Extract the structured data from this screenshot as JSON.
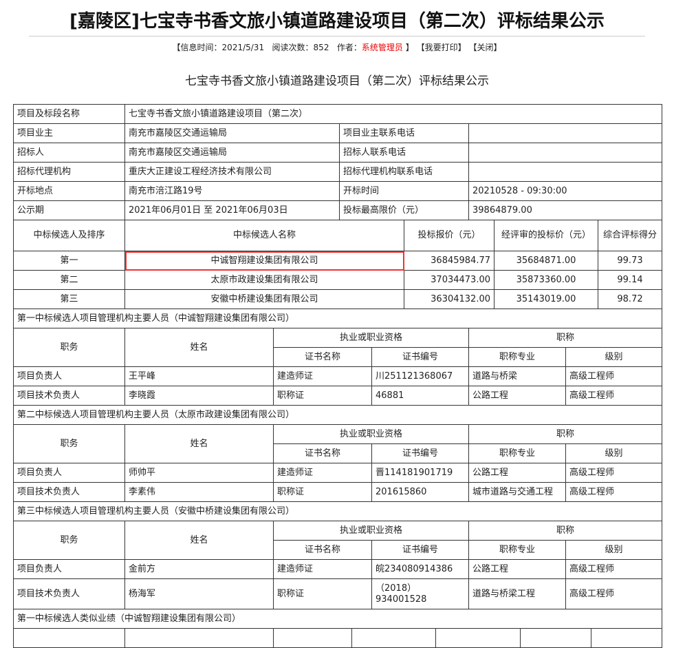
{
  "title": "[嘉陵区]七宝寺书香文旅小镇道路建设项目（第二次）评标结果公示",
  "meta": {
    "info_time_label": "【信息时间：",
    "info_time": "2021/5/31",
    "reads_label": "阅读次数：",
    "reads": "852",
    "author_label": "作者：",
    "author": "系统管理员",
    "close_bracket": "】",
    "print": "【我要打印】",
    "close": "【关闭】"
  },
  "subtitle": "七宝寺书香文旅小镇道路建设项目（第二次）评标结果公示",
  "info": {
    "project_label": "项目及标段名称",
    "project": "七宝寺书香文旅小镇道路建设项目（第二次）",
    "owner_label": "项目业主",
    "owner": "南充市嘉陵区交通运输局",
    "owner_phone_label": "项目业主联系电话",
    "owner_phone": "",
    "tenderer_label": "招标人",
    "tenderer": "南充市嘉陵区交通运输局",
    "tenderer_phone_label": "招标人联系电话",
    "tenderer_phone": "",
    "agency_label": "招标代理机构",
    "agency": "重庆大正建设工程经济技术有限公司",
    "agency_phone_label": "招标代理机构联系电话",
    "agency_phone": "",
    "site_label": "开标地点",
    "site": "南充市涪江路19号",
    "time_label": "开标时间",
    "time": "20210528 - 09:30:00",
    "period_label": "公示期",
    "period": "2021年06月01日 至 2021年06月03日",
    "max_label": "投标最高限价（元）",
    "max": "39864879.00"
  },
  "candidates": {
    "headers": [
      "中标候选人及排序",
      "中标候选人名称",
      "投标报价（元）",
      "经评审的投标价（元）",
      "综合评标得分"
    ],
    "rows": [
      [
        "第一",
        "中诚智翔建设集团有限公司",
        "36845984.77",
        "35684871.00",
        "99.73"
      ],
      [
        "第二",
        "太原市政建设集团有限公司",
        "37034473.00",
        "35873360.00",
        "99.14"
      ],
      [
        "第三",
        "安徽中桥建设集团有限公司",
        "36304132.00",
        "35143019.00",
        "98.72"
      ]
    ]
  },
  "staff_headers": {
    "role": "职务",
    "name": "姓名",
    "qual": "执业或职业资格",
    "title": "职称",
    "cert_name": "证书名称",
    "cert_no": "证书编号",
    "major": "职称专业",
    "level": "级别"
  },
  "staff": [
    {
      "heading": "第一中标候选人项目管理机构主要人员（中诚智翔建设集团有限公司）",
      "rows": [
        [
          "项目负责人",
          "王平峰",
          "建造师证",
          "川251121368067",
          "道路与桥梁",
          "高级工程师"
        ],
        [
          "项目技术负责人",
          "李晓霞",
          "职称证",
          "46881",
          "公路工程",
          "高级工程师"
        ]
      ]
    },
    {
      "heading": "第二中标候选人项目管理机构主要人员（太原市政建设集团有限公司）",
      "rows": [
        [
          "项目负责人",
          "师帅平",
          "建造师证",
          "晋114181901719",
          "公路工程",
          "高级工程师"
        ],
        [
          "项目技术负责人",
          "李素伟",
          "职称证",
          "201615860",
          "城市道路与交通工程",
          "高级工程师"
        ]
      ]
    },
    {
      "heading": "第三中标候选人项目管理机构主要人员（安徽中桥建设集团有限公司）",
      "rows": [
        [
          "项目负责人",
          "金前方",
          "建造师证",
          "皖234080914386",
          "公路工程",
          "高级工程师"
        ],
        [
          "项目技术负责人",
          "杨海军",
          "职称证",
          "（2018）934001528",
          "道路与桥梁工程",
          "高级工程师"
        ]
      ]
    }
  ],
  "performance_heading": "第一中标候选人类似业绩（中诚智翔建设集团有限公司）"
}
